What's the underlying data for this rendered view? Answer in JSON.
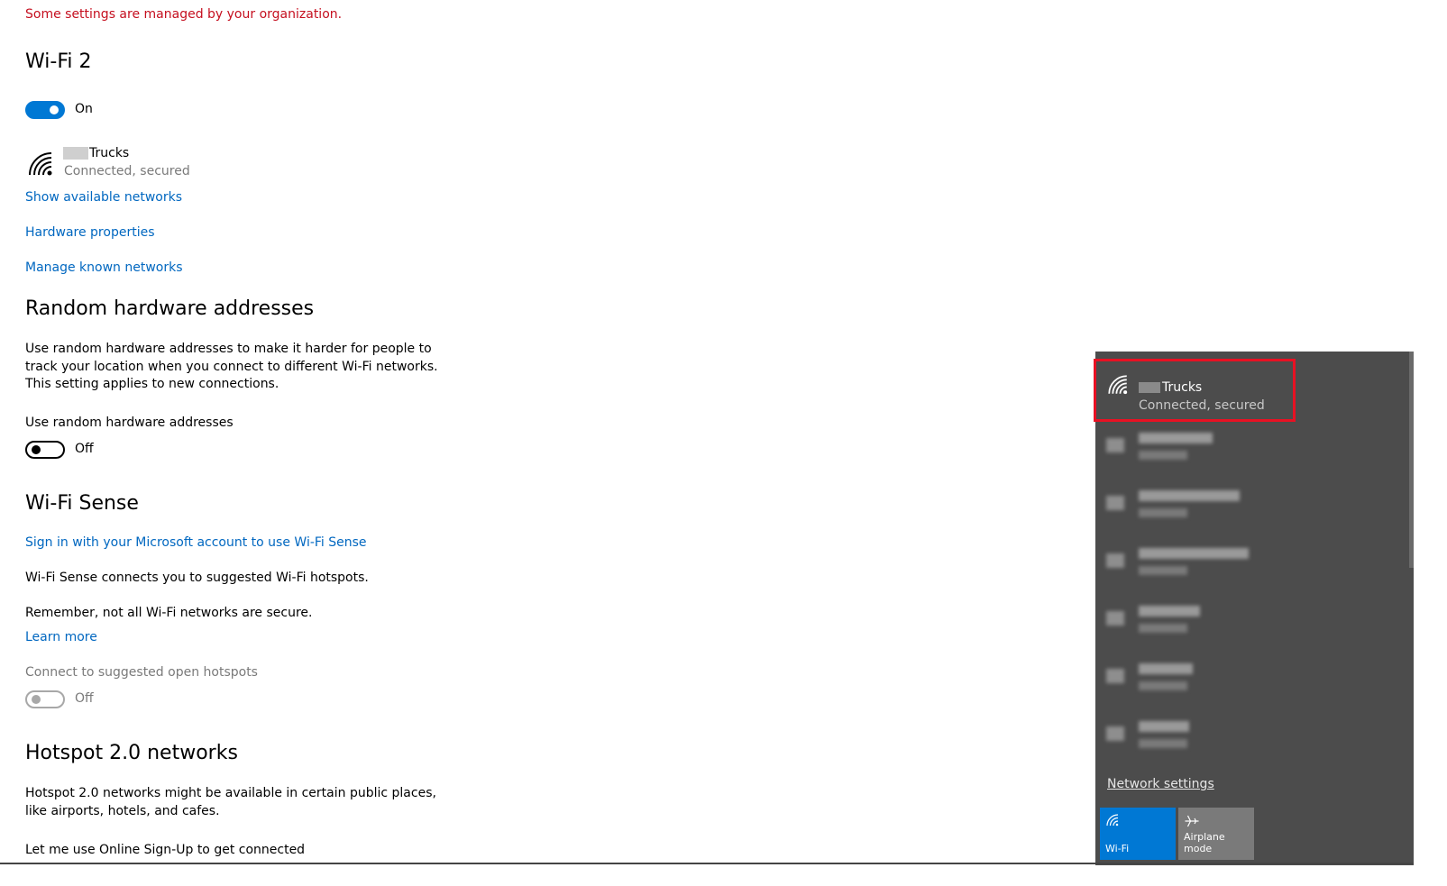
{
  "managed_notice": "Some settings are managed by your organization.",
  "wifi": {
    "title": "Wi-Fi 2",
    "toggle_label": "On",
    "network_name": "Trucks",
    "network_status": "Connected, secured",
    "show_networks": "Show available networks",
    "hardware_properties": "Hardware properties",
    "manage_networks": "Manage known networks"
  },
  "random_hw": {
    "title": "Random hardware addresses",
    "desc1": "Use random hardware addresses to make it harder for people to",
    "desc2": "track your location when you connect to different Wi-Fi networks.",
    "desc3": "This setting applies to new connections.",
    "option_label": "Use random hardware addresses",
    "toggle_label": "Off"
  },
  "wifi_sense": {
    "title": "Wi-Fi Sense",
    "signin_link": "Sign in with your Microsoft account to use Wi-Fi Sense",
    "desc": "Wi-Fi Sense connects you to suggested Wi-Fi hotspots.",
    "remember": "Remember, not all Wi-Fi networks are secure.",
    "learn_more": "Learn more",
    "hotspots_label": "Connect to suggested open hotspots",
    "toggle_label": "Off"
  },
  "hotspot": {
    "title": "Hotspot 2.0 networks",
    "desc1": "Hotspot 2.0 networks might be available in certain public places,",
    "desc2": "like airports, hotels, and cafes.",
    "online_signup": "Let me use Online Sign-Up to get connected"
  },
  "flyout": {
    "connected": {
      "name": "Trucks",
      "status": "Connected, secured"
    },
    "network_settings": "Network settings",
    "tiles": {
      "wifi": "Wi-Fi",
      "airplane": "Airplane mode"
    }
  },
  "colors": {
    "accent": "#0078d4",
    "link": "#0067c0",
    "warning": "#c50f1f",
    "flyout_bg": "#4c4c4c",
    "highlight": "#e81123"
  }
}
